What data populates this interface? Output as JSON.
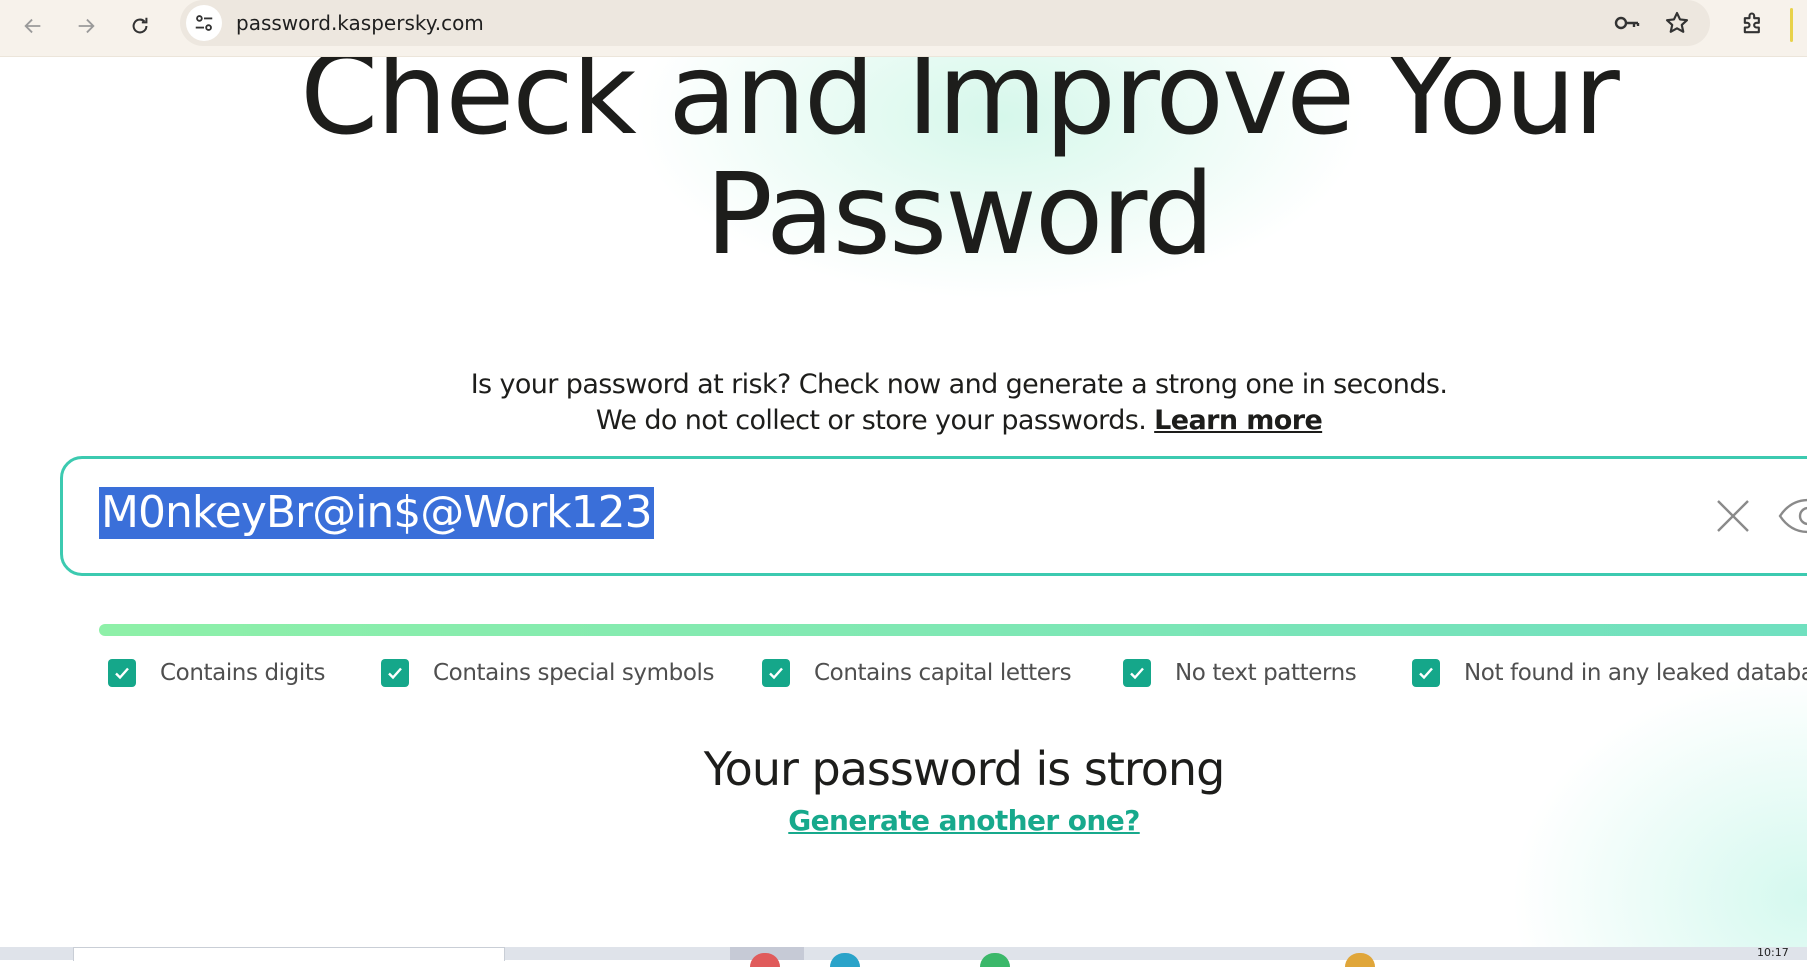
{
  "browser": {
    "url": "password.kaspersky.com",
    "icons": [
      "back-arrow-icon",
      "forward-arrow-icon",
      "reload-icon",
      "site-info-icon",
      "password-key-icon",
      "bookmark-star-icon",
      "extensions-puzzle-icon"
    ]
  },
  "hero": {
    "title_line1": "Check and Improve Your",
    "title_line2": "Password"
  },
  "subtitle": {
    "line1": "Is your password at risk? Check now and generate a strong one in seconds.",
    "line2": "We do not collect or store your passwords.",
    "learn_more": "Learn more"
  },
  "password_field": {
    "value": "M0nkeyBr@in$@Work123",
    "selected": true,
    "icons": [
      "close-icon",
      "eye-icon"
    ]
  },
  "strength": {
    "fill": 1.0,
    "colors": [
      "#8ef0a8",
      "#6fdfc0"
    ]
  },
  "checks": [
    {
      "label": "Contains digits",
      "checked": true
    },
    {
      "label": "Contains special symbols",
      "checked": true
    },
    {
      "label": "Contains capital letters",
      "checked": true
    },
    {
      "label": "No text patterns",
      "checked": true
    },
    {
      "label": "Not found in any leaked database",
      "checked": true
    }
  ],
  "result": {
    "message": "Your password is strong",
    "generate_link": "Generate another one?"
  },
  "colors": {
    "accent": "#3ccab0",
    "check": "#15a78a",
    "link": "#17a98c",
    "selection": "#3a6fd9"
  },
  "taskbar": {
    "clock": "10:17"
  }
}
